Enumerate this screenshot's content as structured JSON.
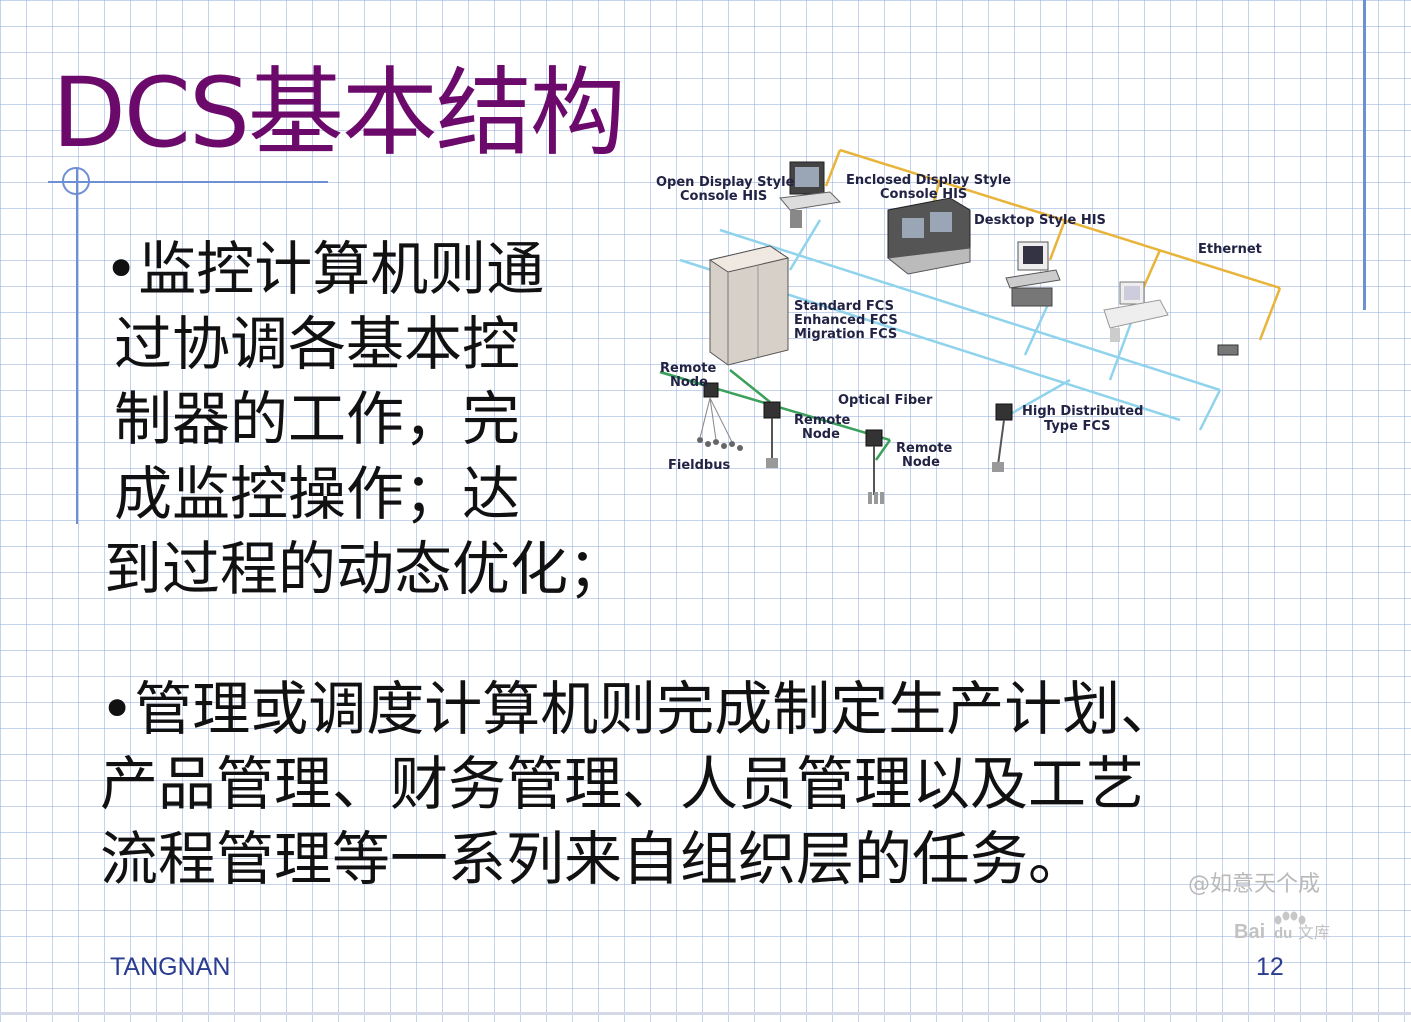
{
  "slide": {
    "title": "DCS基本结构",
    "bullet1": {
      "marker": "•",
      "lines": [
        "监控计算机则通",
        "过协调各基本控",
        "制器的工作，完",
        "成监控操作；达",
        "到过程的动态优化；"
      ]
    },
    "bullet2": {
      "marker": "•",
      "lines": [
        "管理或调度计算机则完成制定生产计划、",
        "产品管理、财务管理、人员管理以及工艺",
        "流程管理等一系列来自组织层的任务。"
      ]
    }
  },
  "diagram": {
    "labels": {
      "open_display_1": "Open Display Style",
      "open_display_2": "Console HIS",
      "enclosed_display_1": "Enclosed Display Style",
      "enclosed_display_2": "Console HIS",
      "desktop_his": "Desktop Style HIS",
      "ethernet": "Ethernet",
      "standard_fcs": "Standard FCS",
      "enhanced_fcs": "Enhanced FCS",
      "migration_fcs": "Migration FCS",
      "remote_node_1a": "Remote",
      "remote_node_1b": "Node",
      "optical_fiber": "Optical Fiber",
      "remote_node_2a": "Remote",
      "remote_node_2b": "Node",
      "remote_node_3a": "Remote",
      "remote_node_3b": "Node",
      "fieldbus": "Fieldbus",
      "high_dist_1": "High Distributed",
      "high_dist_2": "Type FCS"
    },
    "colors": {
      "ethernet": "#e8b43a",
      "control_bus": "#8fd3ec",
      "fiber": "#3aa05a"
    }
  },
  "footer": {
    "author": "TANGNAN",
    "page_number": "12"
  },
  "watermark": {
    "user": "@如意天个成",
    "logo_a": "Bai",
    "logo_b": "du",
    "logo_c": "文库"
  },
  "colors": {
    "title": "#6b0a6b",
    "deco": "#6f8fd3",
    "footer": "#2a3d8f"
  }
}
